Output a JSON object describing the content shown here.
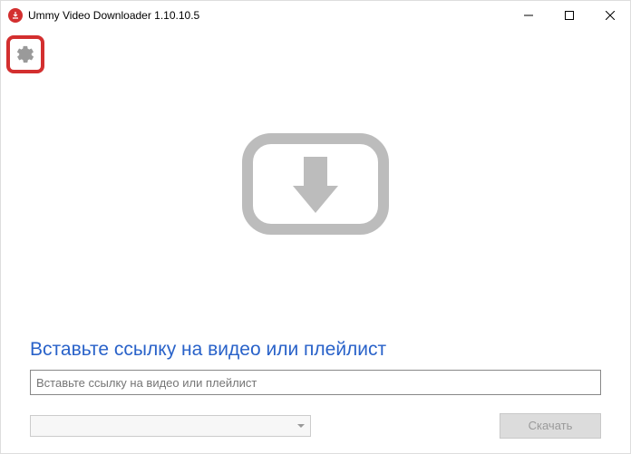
{
  "titlebar": {
    "title": "Ummy Video Downloader 1.10.10.5"
  },
  "main": {
    "prompt_heading": "Вставьте ссылку на видео или плейлист",
    "url_placeholder": "Вставьте ссылку на видео или плейлист",
    "download_label": "Скачать"
  },
  "icons": {
    "app": "download-circle-icon",
    "settings": "gear-icon",
    "minimize": "minimize-icon",
    "maximize": "maximize-icon",
    "close": "close-icon",
    "placeholder": "video-download-placeholder"
  },
  "colors": {
    "accent_red": "#d32f2f",
    "link_blue": "#2962c9",
    "disabled_gray": "#dcdcdc"
  }
}
